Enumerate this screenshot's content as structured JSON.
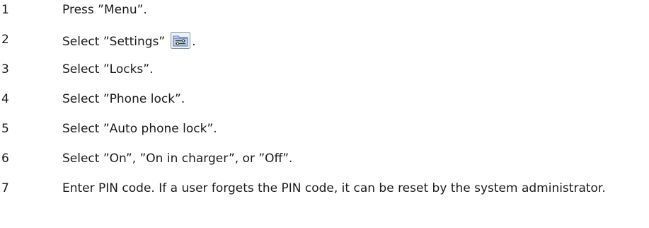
{
  "steps": [
    {
      "number": "1",
      "text": "Press ”Menu”."
    },
    {
      "number": "2",
      "text_before": "Select ”Settings”",
      "icon": "settings-folder-icon",
      "text_after": "."
    },
    {
      "number": "3",
      "text": "Select ”Locks”."
    },
    {
      "number": "4",
      "text": "Select ”Phone lock”."
    },
    {
      "number": "5",
      "text": "Select ”Auto phone lock”."
    },
    {
      "number": "6",
      "text": "Select ”On”, ”On in charger”, or ”Off”."
    },
    {
      "number": "7",
      "text": "Enter PIN code. If a user forgets the PIN code, it can be reset by the system administrator."
    }
  ]
}
